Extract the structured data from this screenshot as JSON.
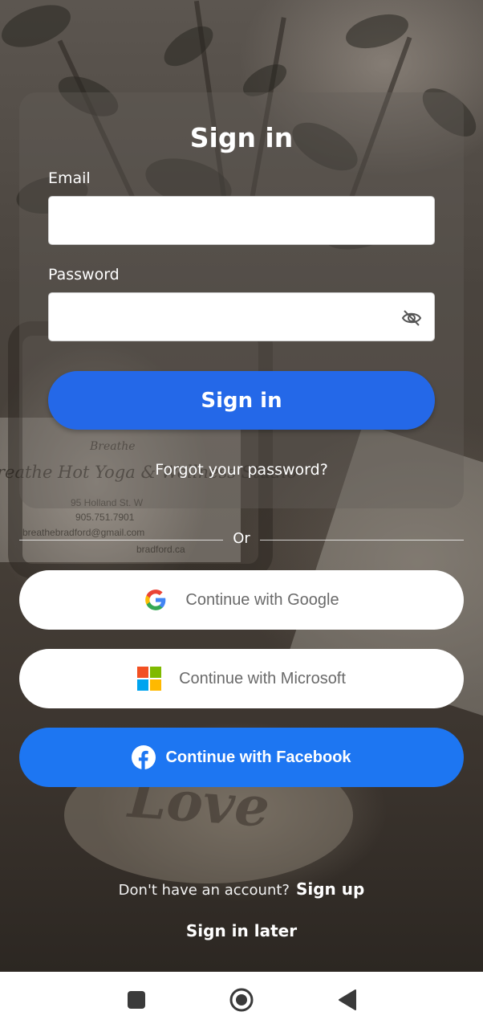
{
  "background": {
    "print_title": "reathe Hot Yoga & Wellness Studio",
    "print_brand": "Breathe",
    "print_address": "95 Holland St. W",
    "print_phone": "905.751.7901",
    "print_email": "breathebradford@gmail.com",
    "print_web": "bradford.ca",
    "stone_text": "Love"
  },
  "signin": {
    "title": "Sign in",
    "email_label": "Email",
    "email_value": "",
    "password_label": "Password",
    "password_value": "",
    "submit_label": "Sign in",
    "forgot_label": "Forgot your password?"
  },
  "divider": {
    "text": "Or"
  },
  "social": {
    "google_label": "Continue with Google",
    "microsoft_label": "Continue with Microsoft",
    "facebook_label": "Continue with Facebook"
  },
  "footer": {
    "account_question": "Don't have an account?",
    "signup_label": "Sign up",
    "later_label": "Sign in later"
  },
  "colors": {
    "primary": "#2468e8",
    "facebook": "#1d76f2",
    "google_blue": "#4285f4",
    "google_red": "#ea4335",
    "google_yellow": "#fbbc05",
    "google_green": "#34a853",
    "ms_red": "#f25022",
    "ms_green": "#7fba00",
    "ms_blue": "#00a4ef",
    "ms_yellow": "#ffb900"
  },
  "icons": {
    "password_toggle": "eye-off-icon",
    "google": "google-icon",
    "microsoft": "microsoft-icon",
    "facebook": "facebook-icon",
    "nav_recents": "square-icon",
    "nav_home": "circle-icon",
    "nav_back": "triangle-back-icon"
  }
}
